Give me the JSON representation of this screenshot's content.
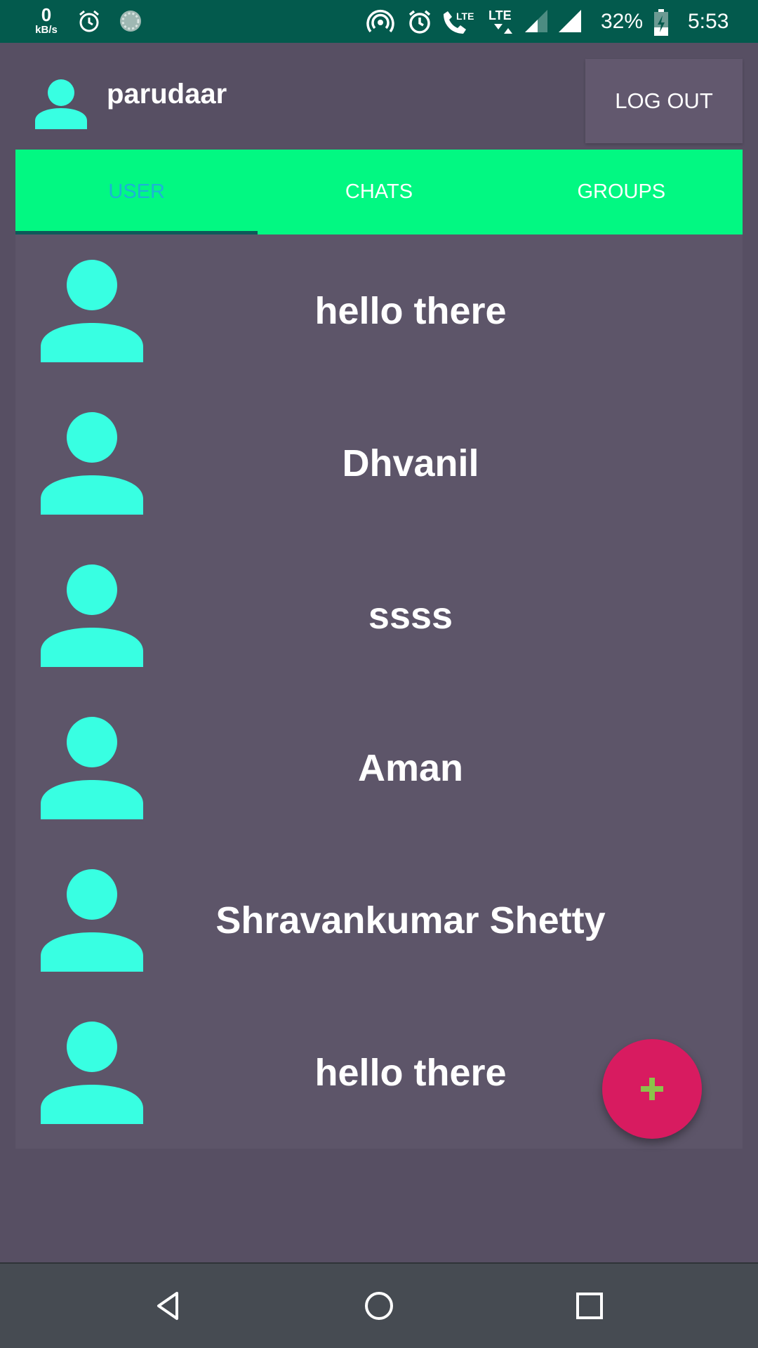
{
  "status_bar": {
    "netspeed_value": "0",
    "netspeed_unit": "kB/s",
    "battery": "32%",
    "time": "5:53",
    "icons": [
      "alarm-icon",
      "loading-icon",
      "hotspot-icon",
      "alarm-icon",
      "lte-call-icon",
      "lte-data-icon",
      "signal-icon",
      "signal-icon",
      "battery-charging-icon"
    ]
  },
  "header": {
    "username": "parudaar",
    "logout_label": "LOG OUT",
    "avatar_icon": "person-icon"
  },
  "tabs": [
    {
      "label": "USER",
      "active": true
    },
    {
      "label": "CHATS",
      "active": false
    },
    {
      "label": "GROUPS",
      "active": false
    }
  ],
  "users": [
    {
      "name": "hello there"
    },
    {
      "name": "Dhvanil"
    },
    {
      "name": "ssss"
    },
    {
      "name": "Aman"
    },
    {
      "name": "Shravankumar Shetty"
    },
    {
      "name": "hello there"
    }
  ],
  "fab": {
    "icon": "plus-icon"
  },
  "nav": {
    "icons": [
      "back-icon",
      "home-icon",
      "recents-icon"
    ]
  },
  "colors": {
    "status_bar": "#035a4d",
    "background": "#574f63",
    "panel": "#5d5569",
    "tab_bar": "#02f882",
    "active_tab_text": "#1db3d6",
    "avatar": "#38ffe2",
    "fab": "#d81b60",
    "fab_icon": "#8bc34a",
    "nav_bar": "#464b52"
  }
}
